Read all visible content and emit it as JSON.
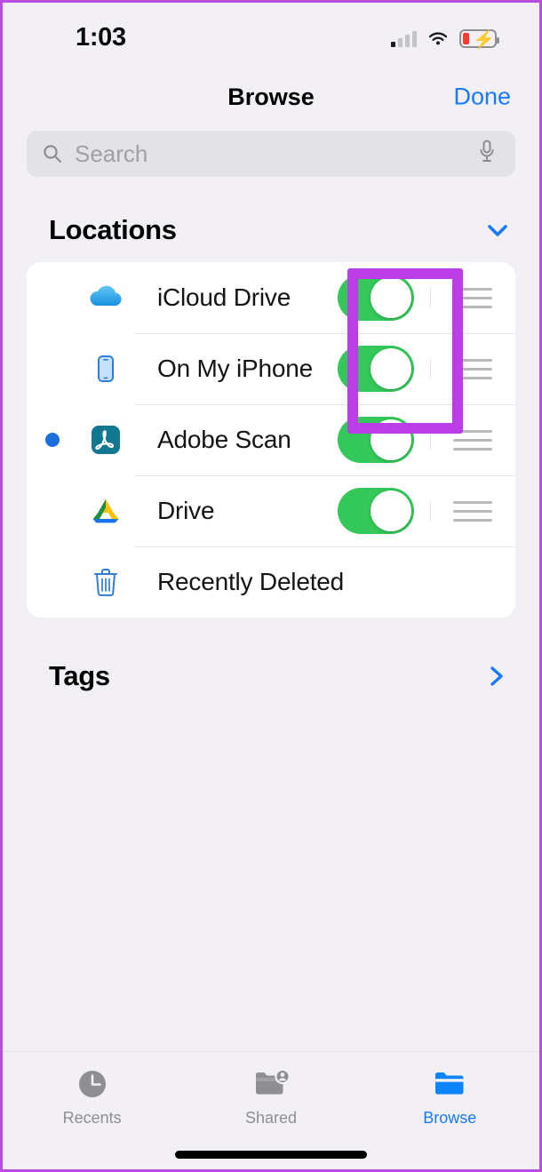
{
  "status_bar": {
    "time": "1:03",
    "cellular_icon": "cellular-signal-icon",
    "cellular_bars_active": 1,
    "wifi_icon": "wifi-icon",
    "battery_icon": "battery-charging-low-icon",
    "battery_low_color": "#ff3b30",
    "battery_charging": true
  },
  "navbar": {
    "title": "Browse",
    "done_label": "Done",
    "done_color": "#1a7aff"
  },
  "search": {
    "placeholder": "Search",
    "value": "",
    "search_icon": "search-icon",
    "mic_icon": "microphone-icon"
  },
  "locations_section": {
    "title": "Locations",
    "collapse_icon": "chevron-down-icon",
    "collapse_icon_color": "#1a7aff",
    "rows": [
      {
        "label": "iCloud Drive",
        "icon": "icloud-drive-icon",
        "has_toggle": true,
        "toggle_on": true,
        "has_reorder_handle": true,
        "has_badge_dot": false
      },
      {
        "label": "On My iPhone",
        "icon": "iphone-icon",
        "has_toggle": true,
        "toggle_on": true,
        "has_reorder_handle": true,
        "has_badge_dot": false
      },
      {
        "label": "Adobe Scan",
        "icon": "adobe-scan-icon",
        "has_toggle": true,
        "toggle_on": true,
        "has_reorder_handle": true,
        "has_badge_dot": true
      },
      {
        "label": "Drive",
        "icon": "google-drive-icon",
        "has_toggle": true,
        "toggle_on": true,
        "has_reorder_handle": true,
        "has_badge_dot": false
      },
      {
        "label": "Recently Deleted",
        "icon": "trash-icon",
        "has_toggle": false,
        "toggle_on": false,
        "has_reorder_handle": false,
        "has_badge_dot": false
      }
    ],
    "toggle_on_color": "#34c759"
  },
  "tags_section": {
    "title": "Tags",
    "disclosure_icon": "chevron-right-icon",
    "disclosure_icon_color": "#1a7aff"
  },
  "annotation": {
    "highlight_color": "#bb3de8",
    "highlight_target": "toggles-for-icloud-drive-and-on-my-iphone"
  },
  "tabbar": {
    "tabs": [
      {
        "label": "Recents",
        "icon": "clock-icon",
        "active": false
      },
      {
        "label": "Shared",
        "icon": "shared-folder-icon",
        "active": false
      },
      {
        "label": "Browse",
        "icon": "folder-icon",
        "active": true
      }
    ],
    "active_color": "#1a7aff",
    "inactive_color": "#8e8e93",
    "home_indicator": "home-indicator-bar"
  }
}
